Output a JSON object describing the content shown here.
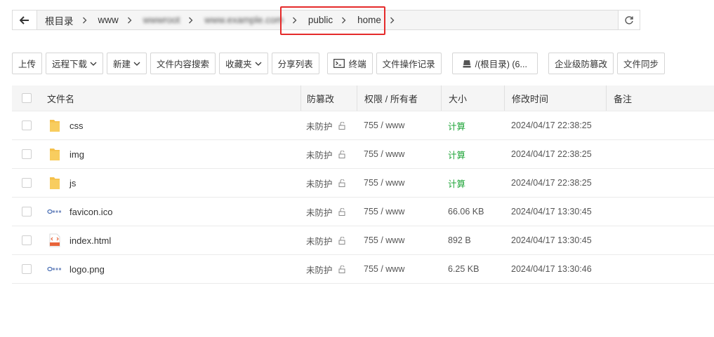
{
  "path": {
    "crumbs": [
      {
        "label": "根目录",
        "blurred": false
      },
      {
        "label": "www",
        "blurred": false
      },
      {
        "label": "wwwroot",
        "blurred": true
      },
      {
        "label": "www.example.com",
        "blurred": true
      },
      {
        "label": "public",
        "blurred": false
      },
      {
        "label": "home",
        "blurred": false
      }
    ]
  },
  "toolbar": {
    "upload": "上传",
    "remote_download": "远程下载",
    "new": "新建",
    "content_search": "文件内容搜索",
    "favorites": "收藏夹",
    "share_list": "分享列表",
    "terminal": "终端",
    "file_op_log": "文件操作记录",
    "disk": "/(根目录) (6...",
    "tamper": "企业级防篡改",
    "sync": "文件同步"
  },
  "table": {
    "headers": {
      "name": "文件名",
      "protect": "防篡改",
      "perm": "权限 / 所有者",
      "size": "大小",
      "mtime": "修改时间",
      "note": "备注"
    },
    "rows": [
      {
        "name": "css",
        "type": "folder",
        "protect": "未防护",
        "perm": "755 / www",
        "size": "计算",
        "mtime": "2024/04/17 22:38:25",
        "note": ""
      },
      {
        "name": "img",
        "type": "folder",
        "protect": "未防护",
        "perm": "755 / www",
        "size": "计算",
        "mtime": "2024/04/17 22:38:25",
        "note": ""
      },
      {
        "name": "js",
        "type": "folder",
        "protect": "未防护",
        "perm": "755 / www",
        "size": "计算",
        "mtime": "2024/04/17 22:38:25",
        "note": ""
      },
      {
        "name": "favicon.ico",
        "type": "image",
        "protect": "未防护",
        "perm": "755 / www",
        "size": "66.06 KB",
        "mtime": "2024/04/17 13:30:45",
        "note": ""
      },
      {
        "name": "index.html",
        "type": "html",
        "protect": "未防护",
        "perm": "755 / www",
        "size": "892 B",
        "mtime": "2024/04/17 13:30:45",
        "note": ""
      },
      {
        "name": "logo.png",
        "type": "image",
        "protect": "未防护",
        "perm": "755 / www",
        "size": "6.25 KB",
        "mtime": "2024/04/17 13:30:46",
        "note": ""
      }
    ]
  },
  "colors": {
    "highlight": "#e52a2a",
    "calc": "#20a53a",
    "folder": "#f5c04a",
    "html": "#e8643a"
  }
}
